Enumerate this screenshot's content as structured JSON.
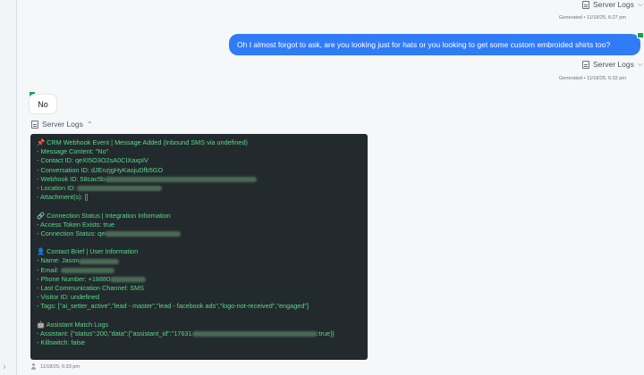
{
  "top_logs": {
    "label": "Server Logs",
    "chevron": "chevron-down"
  },
  "top_meta": "Generated • 11/18/25, 6:27 pm",
  "outgoing": {
    "text": "Oh I almost forgot to ask, are you looking just for hats or you looking to get some custom embroided shirts too?"
  },
  "out_logs": {
    "label": "Server Logs"
  },
  "out_meta": "Generated • 11/18/25, 6:32 pm",
  "incoming": {
    "text": "No"
  },
  "in_logs": {
    "label": "Server Logs"
  },
  "log": {
    "lines": [
      {
        "t": "📌 CRM Webhook Event | Message Added (Inbound SMS via undefined)"
      },
      {
        "t": "- Message Content: \"No\""
      },
      {
        "t": "- Contact ID: qeXI5O3O2sA0CIXaxpIV"
      },
      {
        "t": "- Conversation ID: dJEnzjgHyKaojuDfb5GO"
      },
      {
        "t": "- Webhook ID: 58cac5b",
        "r": 170
      },
      {
        "t": "- Location ID: ",
        "r": 95
      },
      {
        "t": "- Attachment(s): []"
      },
      {
        "t": ""
      },
      {
        "t": "🔗 Connection Status | Integration Information"
      },
      {
        "t": "- Access Token Exists: true"
      },
      {
        "t": "- Connection Status: qe",
        "r": 85
      },
      {
        "t": ""
      },
      {
        "t": "👤 Contact Brief | User Information"
      },
      {
        "t": "- Name: Jason",
        "r": 45
      },
      {
        "t": "- Email: ",
        "r": 60
      },
      {
        "t": "- Phone Number: +18880",
        "r": 40
      },
      {
        "t": "- Last Communication Channel: SMS"
      },
      {
        "t": "- Visitor ID: undefined"
      },
      {
        "t": "- Tags: [\"ai_setter_active\",\"lead - master\",\"lead - facebook ads\",\"logo-not-received\",\"engaged\"]"
      },
      {
        "t": ""
      },
      {
        "t": "🤖 Assistant Match Logs"
      },
      {
        "t": "- Assistant: {\"status\":200,\"data\":{\"assistant_id\":\"17631",
        "r": 140,
        "tail": ":true}}"
      },
      {
        "t": "- Killswitch: false"
      }
    ]
  },
  "footer_meta": "11/18/25, 6:33 pm",
  "colors": {
    "accent": "#2f7cf6",
    "log_bg": "#232a2d",
    "log_text": "#58d98a",
    "badge": "#16a34a"
  }
}
